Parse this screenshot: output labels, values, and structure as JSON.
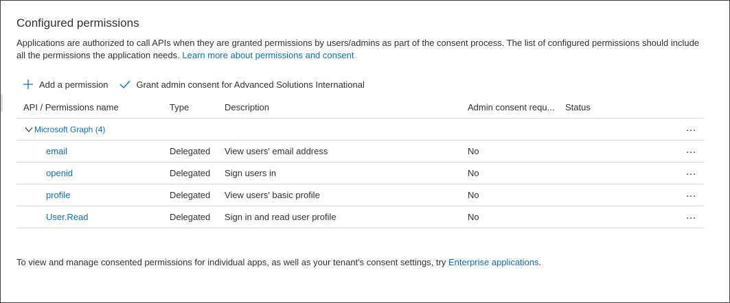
{
  "section": {
    "title": "Configured permissions",
    "intro_text": "Applications are authorized to call APIs when they are granted permissions by users/admins as part of the consent process. The list of configured permissions should include all the permissions the application needs.",
    "intro_link": "Learn more about permissions and consent"
  },
  "toolbar": {
    "add_label": "Add a permission",
    "grant_label": "Grant admin consent for Advanced Solutions International"
  },
  "table": {
    "headers": {
      "api": "API / Permissions name",
      "type": "Type",
      "description": "Description",
      "admin": "Admin consent requ...",
      "status": "Status"
    },
    "group": {
      "label": "Microsoft Graph (4)",
      "more": "…"
    },
    "rows": [
      {
        "name": "email",
        "type": "Delegated",
        "description": "View users' email address",
        "admin": "No",
        "more": "…"
      },
      {
        "name": "openid",
        "type": "Delegated",
        "description": "Sign users in",
        "admin": "No",
        "more": "…"
      },
      {
        "name": "profile",
        "type": "Delegated",
        "description": "View users' basic profile",
        "admin": "No",
        "more": "…"
      },
      {
        "name": "User.Read",
        "type": "Delegated",
        "description": "Sign in and read user profile",
        "admin": "No",
        "more": "…"
      }
    ]
  },
  "footer": {
    "text": "To view and manage consented permissions for individual apps, as well as your tenant's consent settings, try",
    "link": "Enterprise applications",
    "suffix": "."
  },
  "colors": {
    "link": "#0f6cbd",
    "text": "#323130",
    "divider": "#e1dfdd"
  }
}
